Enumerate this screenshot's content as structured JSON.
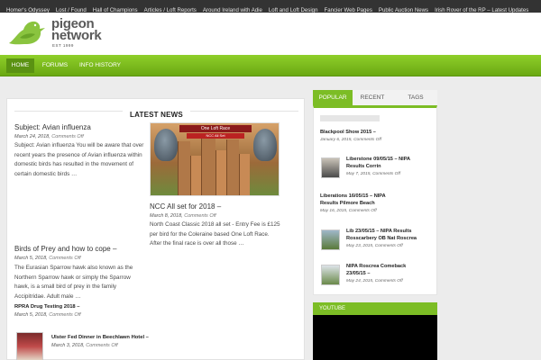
{
  "topbar": {
    "links": [
      "Homer's Odyssey",
      "Lost / Found",
      "Hall of Champions",
      "Articles / Loft Reports",
      "Around Ireland with Adie",
      "Loft and Loft Design",
      "Fancier Web Pages",
      "Public Auction News",
      "Irish Rover of the RP – Latest Updates"
    ]
  },
  "logo": {
    "line1": "pigeon",
    "line2": "network",
    "est": "EST 1999"
  },
  "nav": {
    "items": [
      "HOME",
      "FORUMS",
      "INFO HISTORY"
    ],
    "active": "HOME"
  },
  "main": {
    "section_title": "LATEST NEWS",
    "image_banner": "One Loft Race",
    "image_banner2": "NCC All Set",
    "articles": [
      {
        "title": "Subject: Avian influenza",
        "date": "March 24, 2018,",
        "comments": "Comments Off",
        "excerpt": [
          "Subject: Avian influenza You will be aware that over",
          "recent years the presence of Avian influenza within",
          "domestic birds has resulted in the movement of",
          "certain domestic birds …"
        ]
      },
      {
        "title": "NCC All set for 2018 –",
        "date": "March 8, 2018,",
        "comments": "Comments Off",
        "excerpt": [
          "North Coast Classic 2018 all set - Entry Fee is £125",
          "per bird for the Coleraine based One Loft Race.",
          "After the final race is over all those …"
        ]
      },
      {
        "title": "Birds of Prey and how to cope –",
        "date": "March 5, 2018,",
        "comments": "Comments Off",
        "excerpt": [
          "The Eurasian Sparrow hawk  also known as the",
          "Northern Sparrow hawk or simply the Sparrow",
          "hawk, is a small bird of prey in the family",
          "Accipitridae. Adult male …"
        ]
      },
      {
        "title": "RPRA Drug Testing 2018 –",
        "date": "March 5, 2018,",
        "comments": "Comments Off"
      },
      {
        "title": "Ulster Fed Dinner in Beechlawn Hotel –",
        "date": "March 3, 2018,",
        "comments": "Comments Off"
      }
    ]
  },
  "sidebar": {
    "tabs": [
      "POPULAR",
      "RECENT",
      "TAGS"
    ],
    "active_tab": "POPULAR",
    "posts": [
      {
        "title": "Blackpool Show 2015 –",
        "date": "January 6, 2015,",
        "comments": "Comments Off"
      },
      {
        "title": [
          "Liberstone 09/05/15 – NIPA",
          "Results Corrin"
        ],
        "date": "May 7, 2015,",
        "comments": "Comments Off"
      },
      {
        "title": [
          "Liberations 16/05/15 – NIPA",
          "Results Pilmore Beach"
        ],
        "date": "May 16, 2015,",
        "comments": "Comments Off"
      },
      {
        "title": [
          "Lib 23/05/15 – NIPA Results",
          "Rosscarbery OB Nat Roscrea"
        ],
        "date": "May 23, 2015,",
        "comments": "Comments Off"
      },
      {
        "title": [
          "NIPA Roscrea Comeback",
          "23/05/15 –"
        ],
        "date": "May 24, 2015,",
        "comments": "Comments Off"
      }
    ],
    "youtube_title": "YOUTUBE"
  },
  "colors": {
    "accent": "#7cbd25",
    "topbar": "#333333",
    "nav": "#6aa812",
    "text": "#333333"
  }
}
